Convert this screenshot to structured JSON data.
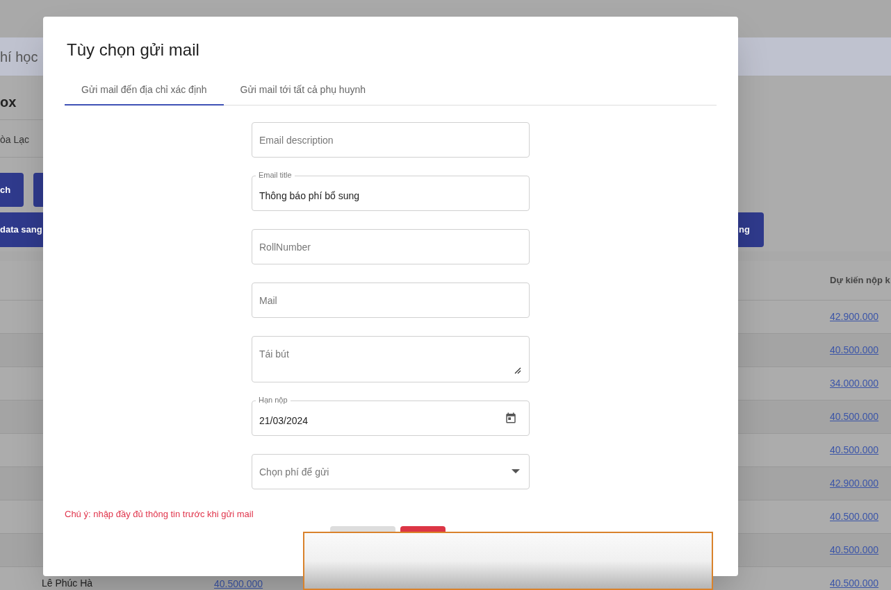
{
  "page": {
    "title": "hí học",
    "card_title": "ox",
    "campus": "òa Lạc",
    "buttons": [
      {
        "label": "ch"
      },
      {
        "label": "data sang"
      }
    ],
    "right_button": "ng"
  },
  "table": {
    "header": "Dự kiến nộp k",
    "rows": [
      {
        "expected": "42.900.000"
      },
      {
        "expected": "40.500.000"
      },
      {
        "expected": "34.000.000"
      },
      {
        "expected": "40.500.000"
      },
      {
        "expected": "40.500.000"
      },
      {
        "expected": "42.900.000"
      },
      {
        "expected": "40.500.000"
      },
      {
        "expected": "40.500.000"
      },
      {
        "name": "Lê Phúc Hà",
        "amount": "40.500.000",
        "expected": "40.500.000"
      }
    ]
  },
  "dialog": {
    "title": "Tùy chọn gửi mail",
    "tabs": [
      {
        "label": "Gửi mail đến địa chỉ xác định",
        "selected": true
      },
      {
        "label": "Gửi mail tới tất cả phụ huynh",
        "selected": false
      }
    ],
    "fields": [
      {
        "kind": "text",
        "placeholder": "Email description"
      },
      {
        "kind": "text",
        "label": "Email title",
        "value": "Thông báo phí bổ sung"
      },
      {
        "kind": "text",
        "placeholder": "RollNumber"
      },
      {
        "kind": "text",
        "placeholder": "Mail"
      },
      {
        "kind": "textarea",
        "placeholder": "Tái bút"
      },
      {
        "kind": "date",
        "label": "Hạn nộp",
        "value": "21/03/2024"
      },
      {
        "kind": "select",
        "placeholder": "Chọn phí để gửi"
      }
    ],
    "note": "Chú ý: nhập đầy đủ thông tin trước khi gửi mail",
    "actions": [
      {
        "kind": "secondary"
      },
      {
        "kind": "danger"
      }
    ]
  }
}
